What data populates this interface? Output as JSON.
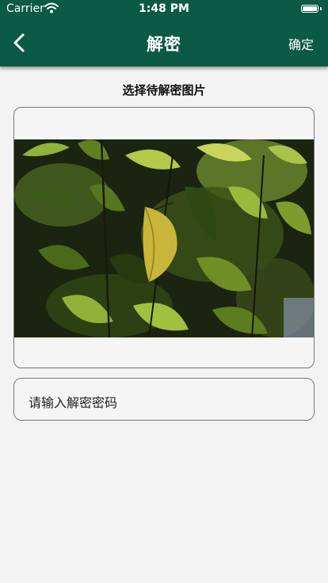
{
  "status_bar": {
    "carrier": "Carrier",
    "time": "1:48 PM"
  },
  "nav": {
    "title": "解密",
    "confirm_label": "确定",
    "back_icon": "chevron-left-icon"
  },
  "content": {
    "section_title": "选择待解密图片",
    "image_alt": "leaves photo",
    "password_placeholder": "请输入解密密码"
  },
  "colors": {
    "header_bg": "#0b5a43",
    "page_bg": "#f3f3f3"
  }
}
